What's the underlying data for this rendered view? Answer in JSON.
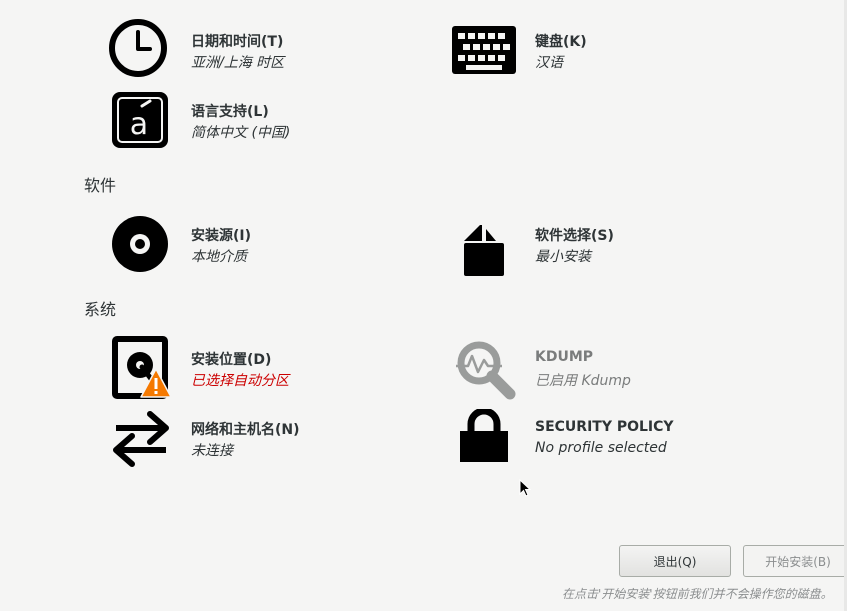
{
  "localization": {
    "datetime": {
      "title": "日期和时间(T)",
      "status": "亚洲/上海 时区"
    },
    "keyboard": {
      "title": "键盘(K)",
      "status": "汉语"
    },
    "language": {
      "title": "语言支持(L)",
      "status": "简体中文 (中国)"
    }
  },
  "software": {
    "label": "软件",
    "source": {
      "title": "安装源(I)",
      "status": "本地介质"
    },
    "selection": {
      "title": "软件选择(S)",
      "status": "最小安装"
    }
  },
  "system": {
    "label": "系统",
    "destination": {
      "title": "安装位置(D)",
      "status": "已选择自动分区"
    },
    "kdump": {
      "title": "KDUMP",
      "status": "已启用 Kdump"
    },
    "network": {
      "title": "网络和主机名(N)",
      "status": "未连接"
    },
    "security": {
      "title": "SECURITY POLICY",
      "status": "No profile selected"
    }
  },
  "buttons": {
    "quit": "退出(Q)",
    "begin": "开始安装(B)"
  },
  "footer": {
    "note": "在点击'开始安装'按钮前我们并不会操作您的磁盘。"
  },
  "colors": {
    "warning": "#cc0000",
    "warning_icon": "#f57900",
    "disabled": "#7a7c7c"
  }
}
